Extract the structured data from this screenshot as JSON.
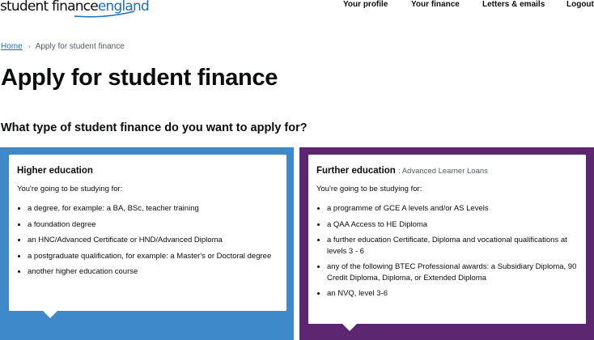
{
  "header": {
    "logo": {
      "part1": "student finance",
      "part2": "england"
    },
    "nav": [
      {
        "label": "Your profile"
      },
      {
        "label": "Your finance"
      },
      {
        "label": "Letters & emails"
      },
      {
        "label": "Logout"
      }
    ]
  },
  "breadcrumb": {
    "home": "Home",
    "current": "Apply for student finance"
  },
  "title": "Apply for student finance",
  "question": "What type of student finance do you want to apply for?",
  "options": [
    {
      "title": "Higher education",
      "subtitle": "",
      "intro": "You're going to be studying for:",
      "bullets": [
        "a degree, for example: a BA, BSc, teacher training",
        "a foundation degree",
        "an HNC/Advanced Certificate or HND/Advanced Diploma",
        "a postgraduate qualification, for example: a Master's or Doctoral degree",
        "another higher education course"
      ]
    },
    {
      "title": "Further education",
      "subtitle": ": Advanced Learner Loans",
      "intro": "You're going to be studying for:",
      "bullets": [
        "a programme of GCE A levels and/or AS Levels",
        "a QAA Access to HE Diploma",
        "a further education Certificate, Diploma and vocational qualifications at levels 3 - 6",
        "any of the following BTEC Professional awards: a Subsidiary Diploma, 90 Credit Diploma, Diploma, or Extended Diploma",
        "an NVQ, level 3-6"
      ]
    }
  ],
  "colors": {
    "higher_education": "#3d89c9",
    "further_education": "#5c2670",
    "link": "#1d70b8"
  }
}
